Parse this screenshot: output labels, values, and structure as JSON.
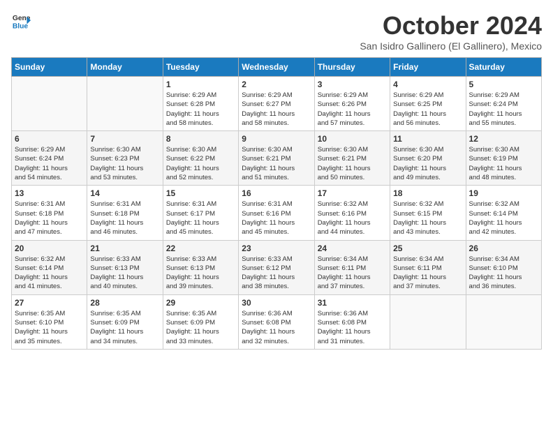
{
  "logo": {
    "general": "General",
    "blue": "Blue"
  },
  "title": "October 2024",
  "subtitle": "San Isidro Gallinero (El Gallinero), Mexico",
  "days_header": [
    "Sunday",
    "Monday",
    "Tuesday",
    "Wednesday",
    "Thursday",
    "Friday",
    "Saturday"
  ],
  "weeks": [
    [
      {
        "day": "",
        "info": ""
      },
      {
        "day": "",
        "info": ""
      },
      {
        "day": "1",
        "info": "Sunrise: 6:29 AM\nSunset: 6:28 PM\nDaylight: 11 hours\nand 58 minutes."
      },
      {
        "day": "2",
        "info": "Sunrise: 6:29 AM\nSunset: 6:27 PM\nDaylight: 11 hours\nand 58 minutes."
      },
      {
        "day": "3",
        "info": "Sunrise: 6:29 AM\nSunset: 6:26 PM\nDaylight: 11 hours\nand 57 minutes."
      },
      {
        "day": "4",
        "info": "Sunrise: 6:29 AM\nSunset: 6:25 PM\nDaylight: 11 hours\nand 56 minutes."
      },
      {
        "day": "5",
        "info": "Sunrise: 6:29 AM\nSunset: 6:24 PM\nDaylight: 11 hours\nand 55 minutes."
      }
    ],
    [
      {
        "day": "6",
        "info": "Sunrise: 6:29 AM\nSunset: 6:24 PM\nDaylight: 11 hours\nand 54 minutes."
      },
      {
        "day": "7",
        "info": "Sunrise: 6:30 AM\nSunset: 6:23 PM\nDaylight: 11 hours\nand 53 minutes."
      },
      {
        "day": "8",
        "info": "Sunrise: 6:30 AM\nSunset: 6:22 PM\nDaylight: 11 hours\nand 52 minutes."
      },
      {
        "day": "9",
        "info": "Sunrise: 6:30 AM\nSunset: 6:21 PM\nDaylight: 11 hours\nand 51 minutes."
      },
      {
        "day": "10",
        "info": "Sunrise: 6:30 AM\nSunset: 6:21 PM\nDaylight: 11 hours\nand 50 minutes."
      },
      {
        "day": "11",
        "info": "Sunrise: 6:30 AM\nSunset: 6:20 PM\nDaylight: 11 hours\nand 49 minutes."
      },
      {
        "day": "12",
        "info": "Sunrise: 6:30 AM\nSunset: 6:19 PM\nDaylight: 11 hours\nand 48 minutes."
      }
    ],
    [
      {
        "day": "13",
        "info": "Sunrise: 6:31 AM\nSunset: 6:18 PM\nDaylight: 11 hours\nand 47 minutes."
      },
      {
        "day": "14",
        "info": "Sunrise: 6:31 AM\nSunset: 6:18 PM\nDaylight: 11 hours\nand 46 minutes."
      },
      {
        "day": "15",
        "info": "Sunrise: 6:31 AM\nSunset: 6:17 PM\nDaylight: 11 hours\nand 45 minutes."
      },
      {
        "day": "16",
        "info": "Sunrise: 6:31 AM\nSunset: 6:16 PM\nDaylight: 11 hours\nand 45 minutes."
      },
      {
        "day": "17",
        "info": "Sunrise: 6:32 AM\nSunset: 6:16 PM\nDaylight: 11 hours\nand 44 minutes."
      },
      {
        "day": "18",
        "info": "Sunrise: 6:32 AM\nSunset: 6:15 PM\nDaylight: 11 hours\nand 43 minutes."
      },
      {
        "day": "19",
        "info": "Sunrise: 6:32 AM\nSunset: 6:14 PM\nDaylight: 11 hours\nand 42 minutes."
      }
    ],
    [
      {
        "day": "20",
        "info": "Sunrise: 6:32 AM\nSunset: 6:14 PM\nDaylight: 11 hours\nand 41 minutes."
      },
      {
        "day": "21",
        "info": "Sunrise: 6:33 AM\nSunset: 6:13 PM\nDaylight: 11 hours\nand 40 minutes."
      },
      {
        "day": "22",
        "info": "Sunrise: 6:33 AM\nSunset: 6:13 PM\nDaylight: 11 hours\nand 39 minutes."
      },
      {
        "day": "23",
        "info": "Sunrise: 6:33 AM\nSunset: 6:12 PM\nDaylight: 11 hours\nand 38 minutes."
      },
      {
        "day": "24",
        "info": "Sunrise: 6:34 AM\nSunset: 6:11 PM\nDaylight: 11 hours\nand 37 minutes."
      },
      {
        "day": "25",
        "info": "Sunrise: 6:34 AM\nSunset: 6:11 PM\nDaylight: 11 hours\nand 37 minutes."
      },
      {
        "day": "26",
        "info": "Sunrise: 6:34 AM\nSunset: 6:10 PM\nDaylight: 11 hours\nand 36 minutes."
      }
    ],
    [
      {
        "day": "27",
        "info": "Sunrise: 6:35 AM\nSunset: 6:10 PM\nDaylight: 11 hours\nand 35 minutes."
      },
      {
        "day": "28",
        "info": "Sunrise: 6:35 AM\nSunset: 6:09 PM\nDaylight: 11 hours\nand 34 minutes."
      },
      {
        "day": "29",
        "info": "Sunrise: 6:35 AM\nSunset: 6:09 PM\nDaylight: 11 hours\nand 33 minutes."
      },
      {
        "day": "30",
        "info": "Sunrise: 6:36 AM\nSunset: 6:08 PM\nDaylight: 11 hours\nand 32 minutes."
      },
      {
        "day": "31",
        "info": "Sunrise: 6:36 AM\nSunset: 6:08 PM\nDaylight: 11 hours\nand 31 minutes."
      },
      {
        "day": "",
        "info": ""
      },
      {
        "day": "",
        "info": ""
      }
    ]
  ]
}
